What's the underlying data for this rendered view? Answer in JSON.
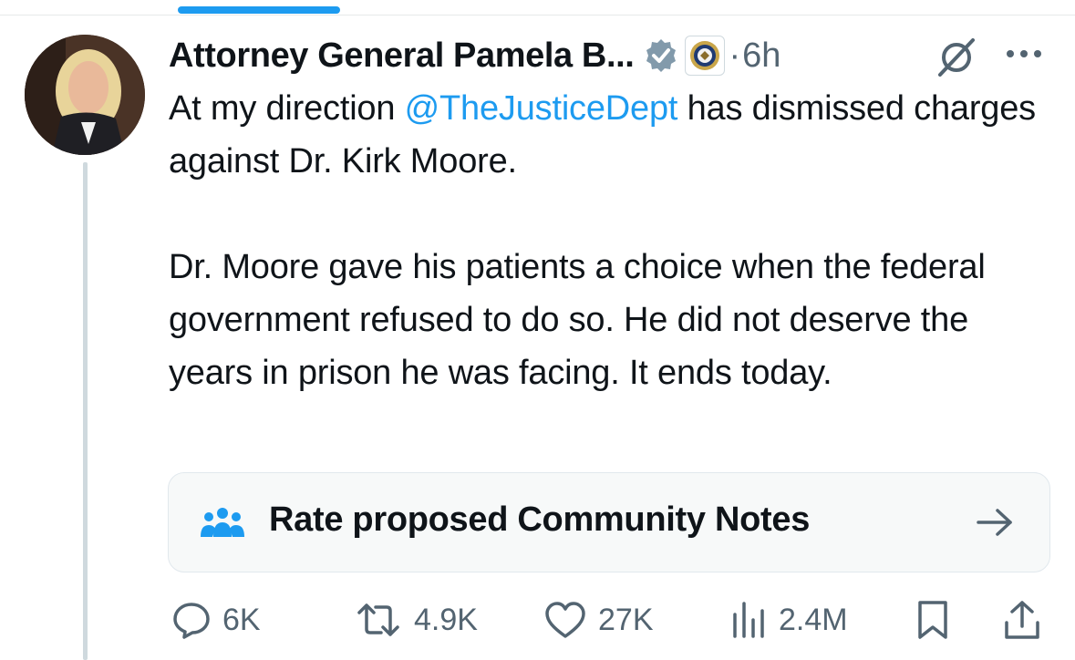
{
  "tweet": {
    "author_name": "Attorney General Pamela B...",
    "separator": "·",
    "time": "6h",
    "mention": "@TheJusticeDept",
    "text_intro": "At my direction ",
    "text_rest": " has dismissed charges against Dr. Kirk Moore.",
    "text_para2": "Dr. Moore gave his patients a choice when the federal government refused to do so. He did not deserve the years in prison he was facing. It ends today."
  },
  "community_notes": {
    "label": "Rate proposed Community Notes"
  },
  "actions": {
    "replies": "6K",
    "reposts": "4.9K",
    "likes": "27K",
    "views": "2.4M"
  },
  "colors": {
    "accent": "#1d9bf0",
    "secondary_text": "#536471",
    "primary_text": "#0f1419",
    "verified_badge": "#829aab"
  },
  "icons": [
    "verified-badge-icon",
    "doj-seal-icon",
    "grok-icon",
    "more-icon",
    "community-notes-icon",
    "arrow-right-icon",
    "reply-icon",
    "repost-icon",
    "like-icon",
    "views-icon",
    "bookmark-icon",
    "share-icon"
  ]
}
